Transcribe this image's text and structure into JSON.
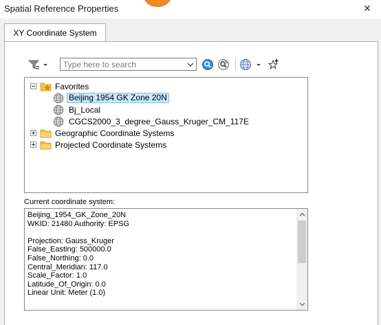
{
  "window": {
    "title": "Spatial Reference Properties",
    "close_glyph": "✕"
  },
  "tabs": [
    {
      "label": "XY Coordinate System"
    }
  ],
  "toolbar": {
    "filter_icon": "filter-icon",
    "search": {
      "placeholder": "Type here to search",
      "value": ""
    },
    "search_icon": "search-icon",
    "clear_search_icon": "clear-search-icon",
    "globe_icon": "globe-icon",
    "add_favorite_icon": "add-to-favorites-icon"
  },
  "tree": {
    "items": [
      {
        "label": "Favorites",
        "icon": "favorites-folder-icon",
        "expander": "−"
      },
      {
        "label": "Beijing 1954 GK Zone 20N",
        "icon": "globe-icon",
        "selected": true
      },
      {
        "label": "Bj_Local",
        "icon": "globe-icon"
      },
      {
        "label": "CGCS2000_3_degree_Gauss_Kruger_CM_117E",
        "icon": "globe-icon"
      },
      {
        "label": "Geographic Coordinate Systems",
        "icon": "folder-icon",
        "expander": "+"
      },
      {
        "label": "Projected Coordinate Systems",
        "icon": "folder-icon",
        "expander": "+"
      }
    ]
  },
  "current_system": {
    "label": "Current coordinate system:",
    "lines": [
      "Beijing_1954_GK_Zone_20N",
      "WKID: 21480 Authority: EPSG",
      "",
      "Projection: Gauss_Kruger",
      "False_Easting: 500000.0",
      "False_Northing: 0.0",
      "Central_Meridian: 117.0",
      "Scale_Factor: 1.0",
      "Latitude_Of_Origin: 0.0",
      "Linear Unit: Meter (1.0)"
    ]
  },
  "colors": {
    "selection": "#cce8ff",
    "selection_border": "#26a0da",
    "folder": "#f5c242",
    "badge": "#f08a24"
  }
}
